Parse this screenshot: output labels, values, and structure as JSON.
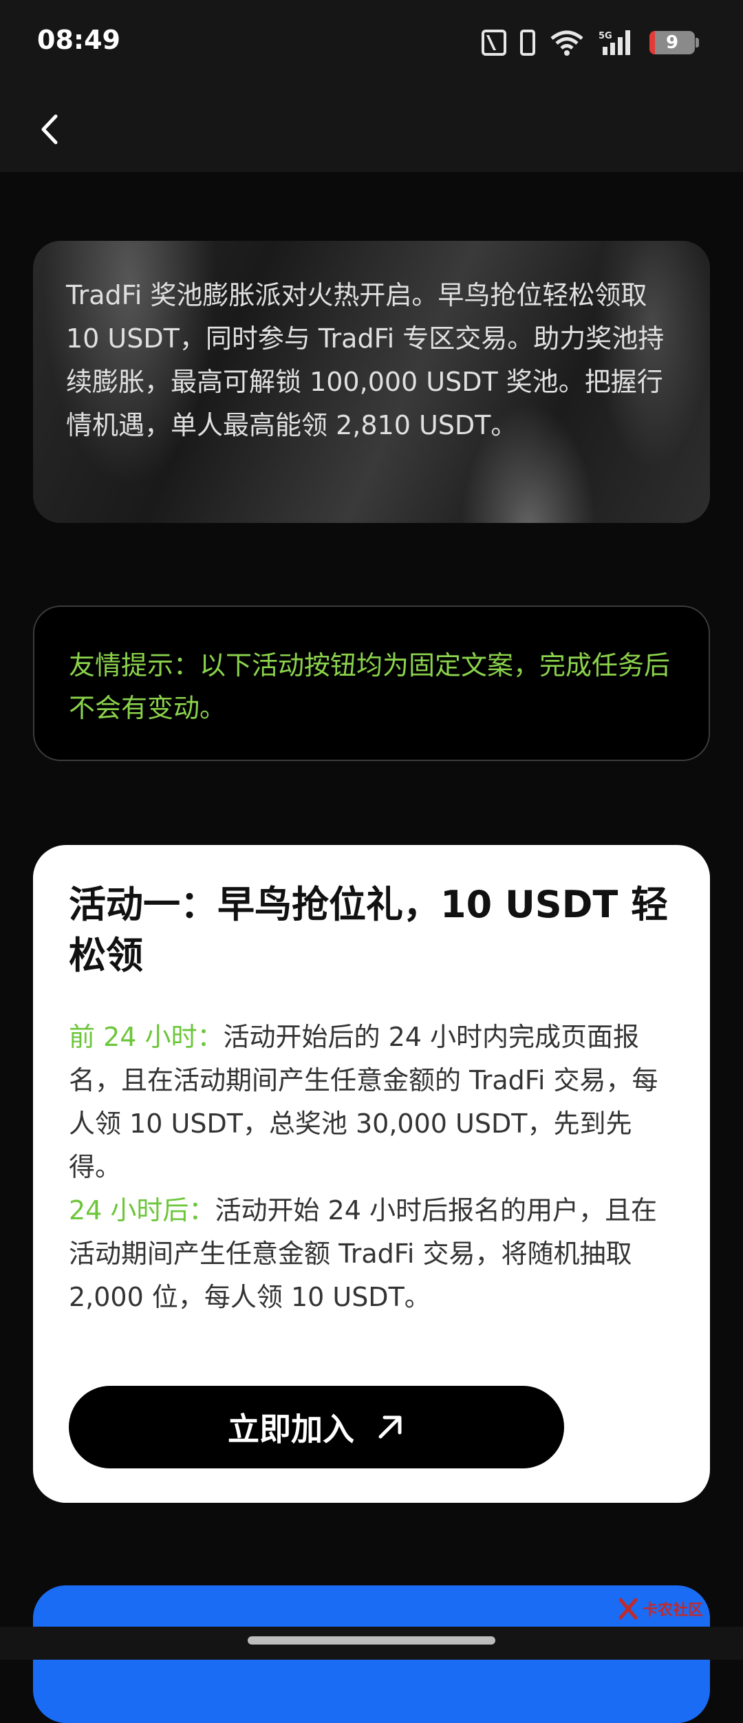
{
  "status_bar": {
    "time": "08:49",
    "battery_level": "9",
    "network_label": "5G"
  },
  "intro": {
    "text": "TradFi 奖池膨胀派对火热开启。早鸟抢位轻松领取 10 USDT，同时参与 TradFi 专区交易。助力奖池持续膨胀，最高可解锁 100,000 USDT 奖池。把握行情机遇，单人最高能领 2,810 USDT。"
  },
  "tip": {
    "text": "友情提示：以下活动按钮均为固定文案，完成任务后不会有变动。"
  },
  "activity_one": {
    "title": "活动一：早鸟抢位礼，10 USDT 轻松领",
    "first_label": "前 24 小时：",
    "first_text": "活动开始后的 24 小时内完成页面报名，且在活动期间产生任意金额的 TradFi 交易，每人领 10 USDT，总奖池 30,000 USDT，先到先得。",
    "second_label": "24 小时后：",
    "second_text": "活动开始 24 小时后报名的用户，且在活动期间产生任意金额 TradFi 交易，将随机抽取 2,000 位，每人领 10 USDT。",
    "button_label": "立即加入"
  },
  "watermark": {
    "text": "卡农社区"
  },
  "colors": {
    "accent_green": "#8bd34c",
    "highlight_green": "#6cc63a",
    "next_card_blue": "#1a6cf5",
    "background": "#0a0a0a"
  }
}
